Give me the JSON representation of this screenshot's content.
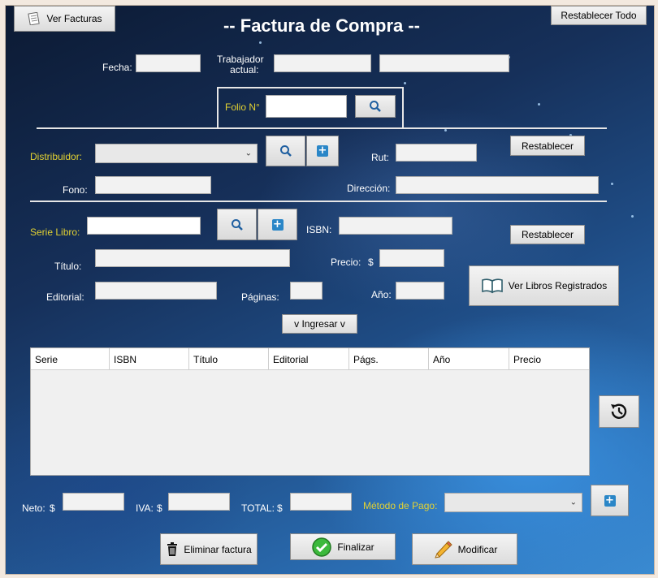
{
  "window": {
    "title": "-- Factura de Compra --"
  },
  "toolbar": {
    "ver_facturas": "Ver Facturas",
    "restablecer_todo": "Restablecer Todo"
  },
  "header": {
    "fecha_label": "Fecha:",
    "trabajador_label_1": "Trabajador",
    "trabajador_label_2": "actual:",
    "folio_label": "Folio N°"
  },
  "distribuidor": {
    "label": "Distribuidor:",
    "rut_label": "Rut:",
    "fono_label": "Fono:",
    "direccion_label": "Dirección:",
    "restablecer": "Restablecer"
  },
  "libro": {
    "serie_label": "Serie Libro:",
    "isbn_label": "ISBN:",
    "titulo_label": "Título:",
    "precio_label": "Precio:",
    "precio_currency": "$",
    "editorial_label": "Editorial:",
    "paginas_label": "Páginas:",
    "anio_label": "Año:",
    "restablecer": "Restablecer",
    "ver_libros": "Ver Libros Registrados",
    "ingresar": "v Ingresar v"
  },
  "table": {
    "columns": [
      "Serie",
      "ISBN",
      "Título",
      "Editorial",
      "Págs.",
      "Año",
      "Precio"
    ]
  },
  "totals": {
    "neto_label": "Neto:",
    "iva_label": "IVA:",
    "total_label": "TOTAL:",
    "currency": "$",
    "metodo_label": "Método de Pago:"
  },
  "actions": {
    "eliminar": "Eliminar factura",
    "finalizar": "Finalizar",
    "modificar": "Modificar"
  },
  "colors": {
    "accent_label": "#e3d232",
    "plus_icon": "#2a86c7",
    "check_icon": "#3cb93c"
  }
}
